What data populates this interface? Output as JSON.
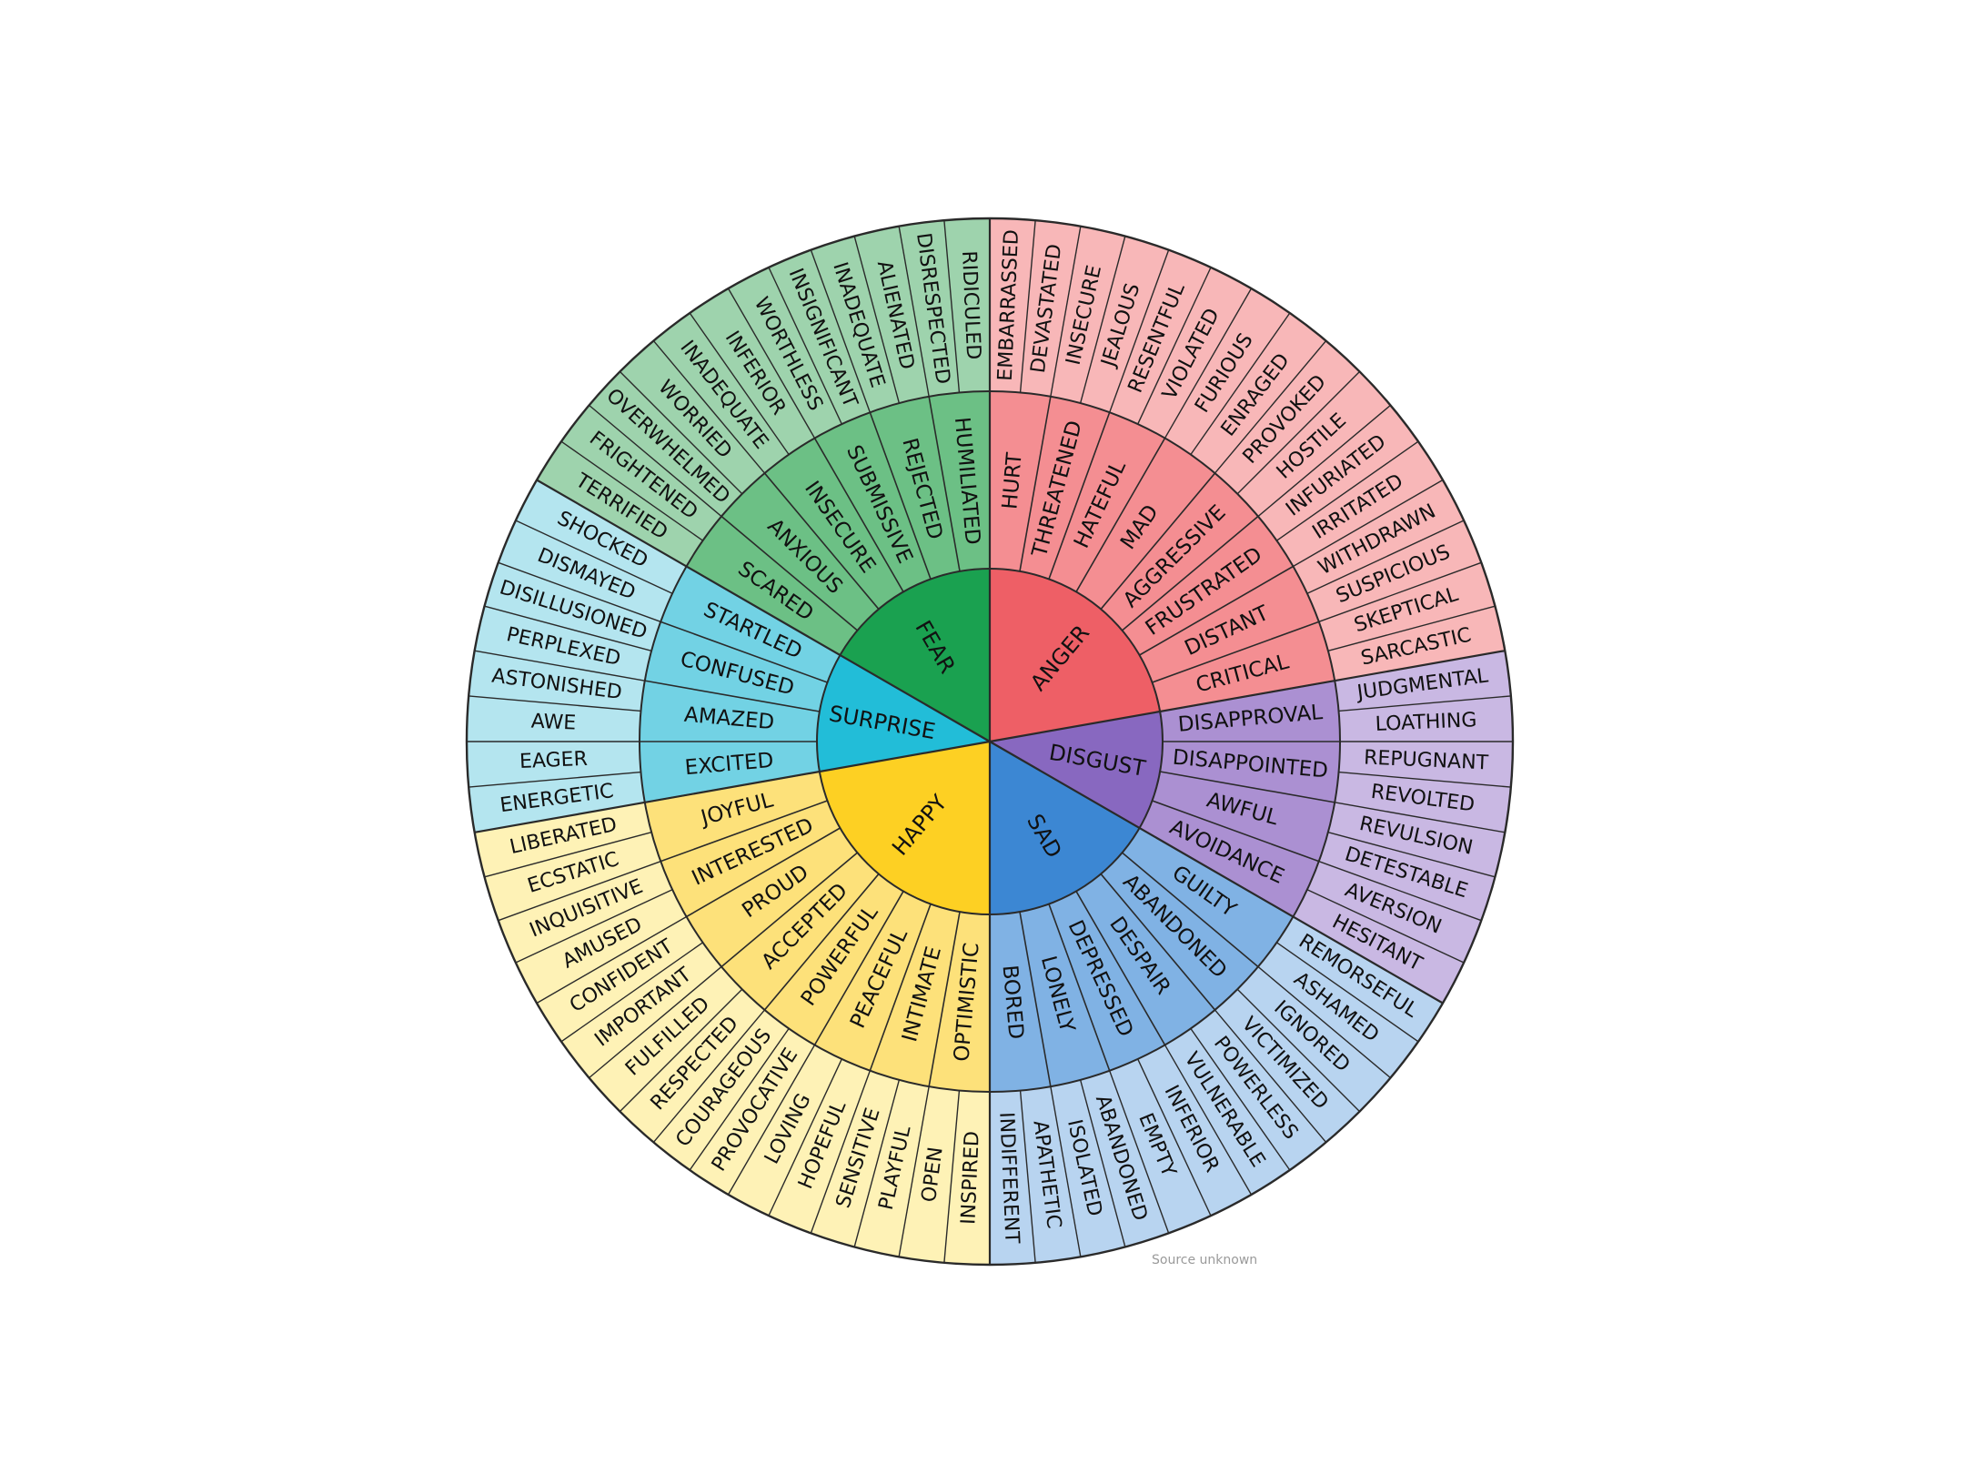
{
  "source_note": "Source unknown",
  "wheel": {
    "start_angle_deg": -90,
    "sectors": [
      {
        "name": "ANGER",
        "colors": {
          "core": "#ee5f66",
          "middle": "#f48e92",
          "outer": "#f8b7b8"
        },
        "middle": [
          {
            "label": "HURT",
            "outer": [
              "EMBARRASSED",
              "DEVASTATED"
            ]
          },
          {
            "label": "THREATENED",
            "outer": [
              "INSECURE",
              "JEALOUS"
            ]
          },
          {
            "label": "HATEFUL",
            "outer": [
              "RESENTFUL",
              "VIOLATED"
            ]
          },
          {
            "label": "MAD",
            "outer": [
              "FURIOUS",
              "ENRAGED"
            ]
          },
          {
            "label": "AGGRESSIVE",
            "outer": [
              "PROVOKED",
              "HOSTILE"
            ]
          },
          {
            "label": "FRUSTRATED",
            "outer": [
              "INFURIATED",
              "IRRITATED"
            ]
          },
          {
            "label": "DISTANT",
            "outer": [
              "WITHDRAWN",
              "SUSPICIOUS"
            ]
          },
          {
            "label": "CRITICAL",
            "outer": [
              "SKEPTICAL",
              "SARCASTIC"
            ]
          }
        ]
      },
      {
        "name": "DISGUST",
        "colors": {
          "core": "#8868c0",
          "middle": "#ab90d2",
          "outer": "#c9b8e3"
        },
        "middle": [
          {
            "label": "DISAPPROVAL",
            "outer": [
              "JUDGMENTAL",
              "LOATHING"
            ]
          },
          {
            "label": "DISAPPOINTED",
            "outer": [
              "REPUGNANT",
              "REVOLTED"
            ]
          },
          {
            "label": "AWFUL",
            "outer": [
              "REVULSION",
              "DETESTABLE"
            ]
          },
          {
            "label": "AVOIDANCE",
            "outer": [
              "AVERSION",
              "HESITANT"
            ]
          }
        ]
      },
      {
        "name": "SAD",
        "colors": {
          "core": "#3c87d3",
          "middle": "#80b2e4",
          "outer": "#b8d4f0"
        },
        "middle": [
          {
            "label": "GUILTY",
            "outer": [
              "REMORSEFUL",
              "ASHAMED"
            ]
          },
          {
            "label": "ABANDONED",
            "outer": [
              "IGNORED",
              "VICTIMIZED"
            ]
          },
          {
            "label": "DESPAIR",
            "outer": [
              "POWERLESS",
              "VULNERABLE"
            ]
          },
          {
            "label": "DEPRESSED",
            "outer": [
              "INFERIOR",
              "EMPTY"
            ]
          },
          {
            "label": "LONELY",
            "outer": [
              "ABANDONED",
              "ISOLATED"
            ]
          },
          {
            "label": "BORED",
            "outer": [
              "APATHETIC",
              "INDIFFERENT"
            ]
          }
        ]
      },
      {
        "name": "HAPPY",
        "colors": {
          "core": "#fdd023",
          "middle": "#fde17a",
          "outer": "#fef2b6"
        },
        "middle": [
          {
            "label": "OPTIMISTIC",
            "outer": [
              "INSPIRED",
              "OPEN"
            ]
          },
          {
            "label": "INTIMATE",
            "outer": [
              "PLAYFUL",
              "SENSITIVE"
            ]
          },
          {
            "label": "PEACEFUL",
            "outer": [
              "HOPEFUL",
              "LOVING"
            ]
          },
          {
            "label": "POWERFUL",
            "outer": [
              "PROVOCATIVE",
              "COURAGEOUS"
            ]
          },
          {
            "label": "ACCEPTED",
            "outer": [
              "RESPECTED",
              "FULFILLED"
            ]
          },
          {
            "label": "PROUD",
            "outer": [
              "IMPORTANT",
              "CONFIDENT"
            ]
          },
          {
            "label": "INTERESTED",
            "outer": [
              "AMUSED",
              "INQUISITIVE"
            ]
          },
          {
            "label": "JOYFUL",
            "outer": [
              "ECSTATIC",
              "LIBERATED"
            ]
          }
        ]
      },
      {
        "name": "SURPRISE",
        "colors": {
          "core": "#22bdd8",
          "middle": "#72d2e4",
          "outer": "#b4e5ef"
        },
        "middle": [
          {
            "label": "EXCITED",
            "outer": [
              "ENERGETIC",
              "EAGER"
            ]
          },
          {
            "label": "AMAZED",
            "outer": [
              "AWE",
              "ASTONISHED"
            ]
          },
          {
            "label": "CONFUSED",
            "outer": [
              "PERPLEXED",
              "DISILLUSIONED"
            ]
          },
          {
            "label": "STARTLED",
            "outer": [
              "DISMAYED",
              "SHOCKED"
            ]
          }
        ]
      },
      {
        "name": "FEAR",
        "colors": {
          "core": "#1aa150",
          "middle": "#6cc085",
          "outer": "#9ed3ad"
        },
        "middle": [
          {
            "label": "SCARED",
            "outer": [
              "TERRIFIED",
              "FRIGHTENED"
            ]
          },
          {
            "label": "ANXIOUS",
            "outer": [
              "OVERWHELMED",
              "WORRIED"
            ]
          },
          {
            "label": "INSECURE",
            "outer": [
              "INADEQUATE",
              "INFERIOR"
            ]
          },
          {
            "label": "SUBMISSIVE",
            "outer": [
              "WORTHLESS",
              "INSIGNIFICANT"
            ]
          },
          {
            "label": "REJECTED",
            "outer": [
              "INADEQUATE",
              "ALIENATED"
            ]
          },
          {
            "label": "HUMILIATED",
            "outer": [
              "DISRESPECTED",
              "RIDICULED"
            ]
          }
        ]
      }
    ]
  }
}
